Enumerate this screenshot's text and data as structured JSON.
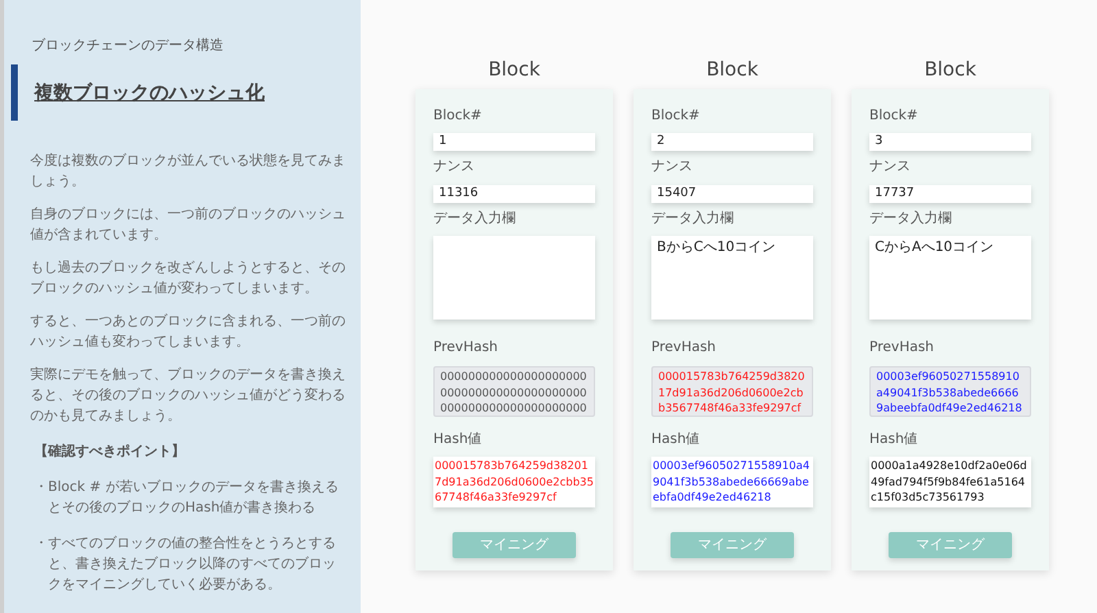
{
  "sidebar": {
    "subtitle": "ブロックチェーンのデータ構造",
    "title": "複数ブロックのハッシュ化",
    "paragraphs": [
      "今度は複数のブロックが並んでいる状態を見てみましょう。",
      "自身のブロックには、一つ前のブロックのハッシュ値が含まれています。",
      "もし過去のブロックを改ざんしようとすると、そのブロックのハッシュ値が変わってしまいます。",
      "すると、一つあとのブロックに含まれる、一つ前のハッシュ値も変わってしまいます。",
      "実際にデモを触って、ブロックのデータを書き換えると、その後のブロックのハッシュ値がどう変わるのかも見てみましょう。"
    ],
    "points_heading": "【確認すべきポイント】",
    "points": [
      {
        "bullet": "・",
        "text": "Block # が若いブロックのデータを書き換えるとその後のブロックのHash値が書き換わる"
      },
      {
        "bullet": "・",
        "text": "すべてのブロックの値の整合性をとうろとすると、書き換えたブロック以降のすべてのブロックをマイニングしていく必要がある。"
      }
    ]
  },
  "blocks": [
    {
      "title": "Block",
      "number_label": "Block#",
      "number": "1",
      "nonce_label": "ナンス",
      "nonce": "11316",
      "data_label": "データ入力欄",
      "prev_label": "PrevHash",
      "prev_hash": {
        "text": "000000000000000000000000000000000000000000000000000000000000000",
        "color": "#555555"
      },
      "hash_label": "Hash値",
      "hash": {
        "text": "000015783b764259d382017d91a36d206d0600e2cbb3567748f46a33fe9297cf",
        "color": "#ff1a1a"
      },
      "button": "マイニング"
    },
    {
      "title": "Block",
      "number_label": "Block#",
      "number": "2",
      "nonce_label": "ナンス",
      "nonce": "15407",
      "data_label": "データ入力欄",
      "data": "BからCへ10コイン",
      "prev_label": "PrevHash",
      "prev_hash": {
        "text": "000015783b764259d382017d91a36d206d0600e2cbb3567748f46a33fe9297cf",
        "color": "#ff1a1a"
      },
      "hash_label": "Hash値",
      "hash": {
        "text": "00003ef96050271558910a49041f3b538abede66669abeebfa0df49e2ed46218",
        "color": "#1a1aff"
      },
      "button": "マイニング"
    },
    {
      "title": "Block",
      "number_label": "Block#",
      "number": "3",
      "nonce_label": "ナンス",
      "nonce": "17737",
      "data_label": "データ入力欄",
      "data": "CからAへ10コイン",
      "prev_label": "PrevHash",
      "prev_hash": {
        "text": "00003ef96050271558910a49041f3b538abede66669abeebfa0df49e2ed46218",
        "color": "#1a1aff"
      },
      "hash_label": "Hash値",
      "hash": {
        "text": "0000a1a4928e10df2a0e06d49fad794f5f9b84fe61a5164c15f03d5c73561793",
        "color": "#111111"
      },
      "button": "マイニング"
    }
  ]
}
